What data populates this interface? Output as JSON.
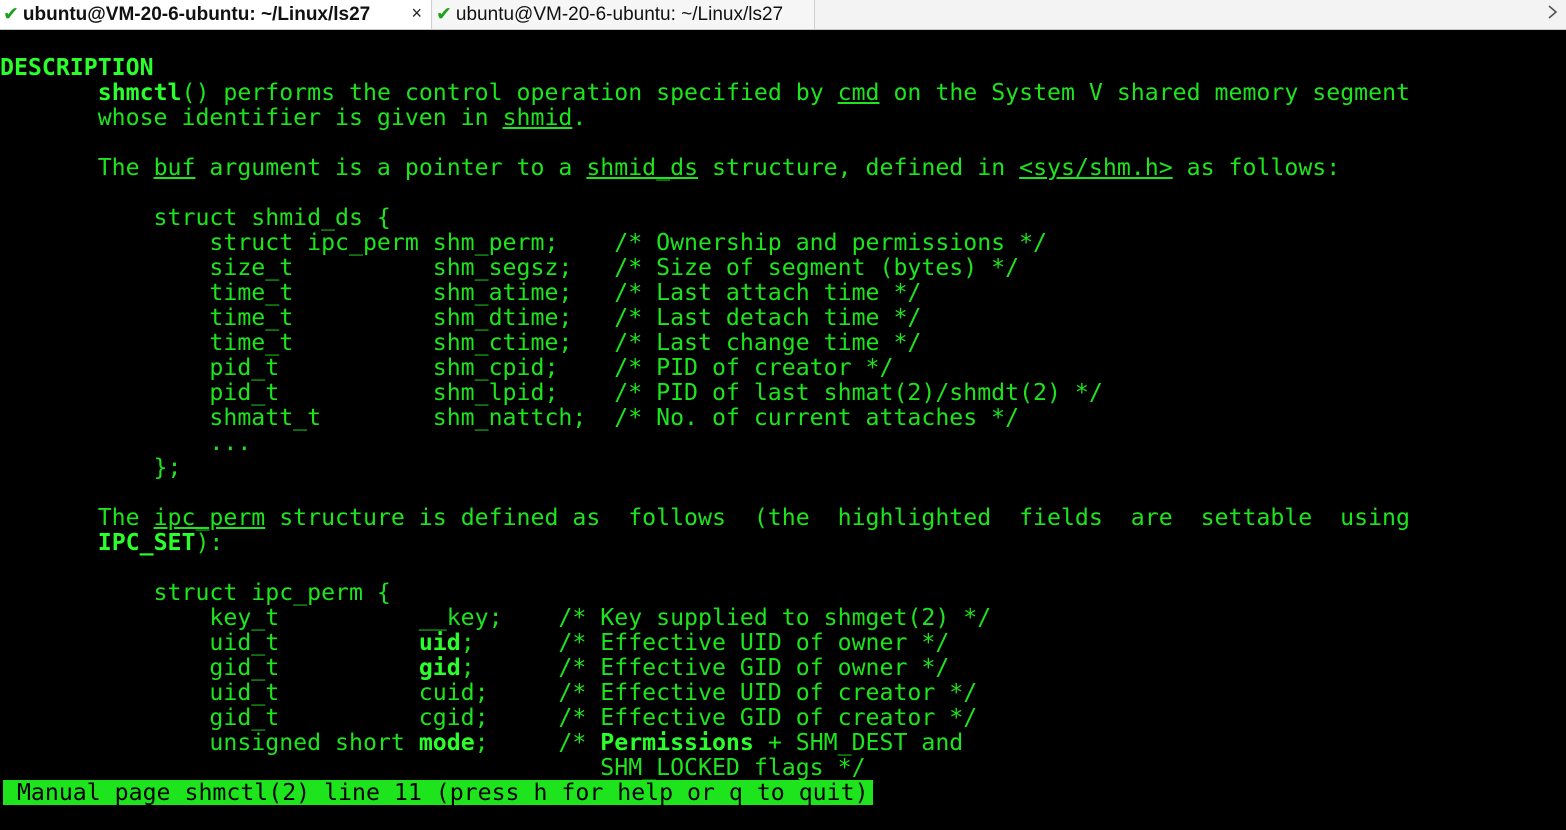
{
  "tabs": [
    {
      "label": "ubuntu@VM-20-6-ubuntu: ~/Linux/ls27",
      "status_icon": "check-icon",
      "active": true,
      "close_glyph": "×"
    },
    {
      "label": "ubuntu@VM-20-6-ubuntu: ~/Linux/ls27",
      "status_icon": "check-icon",
      "active": false
    }
  ],
  "colors": {
    "terminal_bg": "#000000",
    "terminal_fg": "#1ee41e",
    "status_bg": "#1ee41e",
    "check": "#1aa31a"
  },
  "terminal": {
    "lines": [
      {
        "segments": [
          {
            "t": "DESCRIPTION",
            "s": "b"
          }
        ]
      },
      {
        "segments": [
          {
            "t": "       "
          },
          {
            "t": "shmctl",
            "s": "b"
          },
          {
            "t": "() performs the control operation specified by "
          },
          {
            "t": "cmd",
            "s": "u"
          },
          {
            "t": " on the System V shared memory segment"
          }
        ]
      },
      {
        "segments": [
          {
            "t": "       whose identifier is given in "
          },
          {
            "t": "shmid",
            "s": "u"
          },
          {
            "t": "."
          }
        ]
      },
      {
        "segments": []
      },
      {
        "segments": [
          {
            "t": "       The "
          },
          {
            "t": "buf",
            "s": "u"
          },
          {
            "t": " argument is a pointer to a "
          },
          {
            "t": "shmid_ds",
            "s": "u"
          },
          {
            "t": " structure, defined in "
          },
          {
            "t": "<sys/shm.h>",
            "s": "u"
          },
          {
            "t": " as follows:"
          }
        ]
      },
      {
        "segments": []
      },
      {
        "segments": [
          {
            "t": "           struct shmid_ds {"
          }
        ]
      },
      {
        "segments": [
          {
            "t": "               struct ipc_perm shm_perm;    /* Ownership and permissions */"
          }
        ]
      },
      {
        "segments": [
          {
            "t": "               size_t          shm_segsz;   /* Size of segment (bytes) */"
          }
        ]
      },
      {
        "segments": [
          {
            "t": "               time_t          shm_atime;   /* Last attach time */"
          }
        ]
      },
      {
        "segments": [
          {
            "t": "               time_t          shm_dtime;   /* Last detach time */"
          }
        ]
      },
      {
        "segments": [
          {
            "t": "               time_t          shm_ctime;   /* Last change time */"
          }
        ]
      },
      {
        "segments": [
          {
            "t": "               pid_t           shm_cpid;    /* PID of creator */"
          }
        ]
      },
      {
        "segments": [
          {
            "t": "               pid_t           shm_lpid;    /* PID of last shmat(2)/shmdt(2) */"
          }
        ]
      },
      {
        "segments": [
          {
            "t": "               shmatt_t        shm_nattch;  /* No. of current attaches */"
          }
        ]
      },
      {
        "segments": [
          {
            "t": "               ..."
          }
        ]
      },
      {
        "segments": [
          {
            "t": "           };"
          }
        ]
      },
      {
        "segments": []
      },
      {
        "segments": [
          {
            "t": "       The "
          },
          {
            "t": "ipc_perm",
            "s": "u"
          },
          {
            "t": " structure is defined as  follows  (the  highlighted  fields  are  settable  using"
          }
        ]
      },
      {
        "segments": [
          {
            "t": "       "
          },
          {
            "t": "IPC_SET",
            "s": "b"
          },
          {
            "t": "):"
          }
        ]
      },
      {
        "segments": []
      },
      {
        "segments": [
          {
            "t": "           struct ipc_perm {"
          }
        ]
      },
      {
        "segments": [
          {
            "t": "               key_t          __key;    /* Key supplied to shmget(2) */"
          }
        ]
      },
      {
        "segments": [
          {
            "t": "               uid_t          "
          },
          {
            "t": "uid",
            "s": "b"
          },
          {
            "t": ";      /* Effective UID of owner */"
          }
        ]
      },
      {
        "segments": [
          {
            "t": "               gid_t          "
          },
          {
            "t": "gid",
            "s": "b"
          },
          {
            "t": ";      /* Effective GID of owner */"
          }
        ]
      },
      {
        "segments": [
          {
            "t": "               uid_t          cuid;     /* Effective UID of creator */"
          }
        ]
      },
      {
        "segments": [
          {
            "t": "               gid_t          cgid;     /* Effective GID of creator */"
          }
        ]
      },
      {
        "segments": [
          {
            "t": "               unsigned short "
          },
          {
            "t": "mode",
            "s": "b"
          },
          {
            "t": ";     /* "
          },
          {
            "t": "Permissions",
            "s": "b"
          },
          {
            "t": " + SHM_DEST and"
          }
        ]
      },
      {
        "segments": [
          {
            "t": "                                           SHM_LOCKED flags */"
          }
        ]
      }
    ],
    "status": " Manual page shmctl(2) line 11 (press h for help or q to quit)"
  }
}
